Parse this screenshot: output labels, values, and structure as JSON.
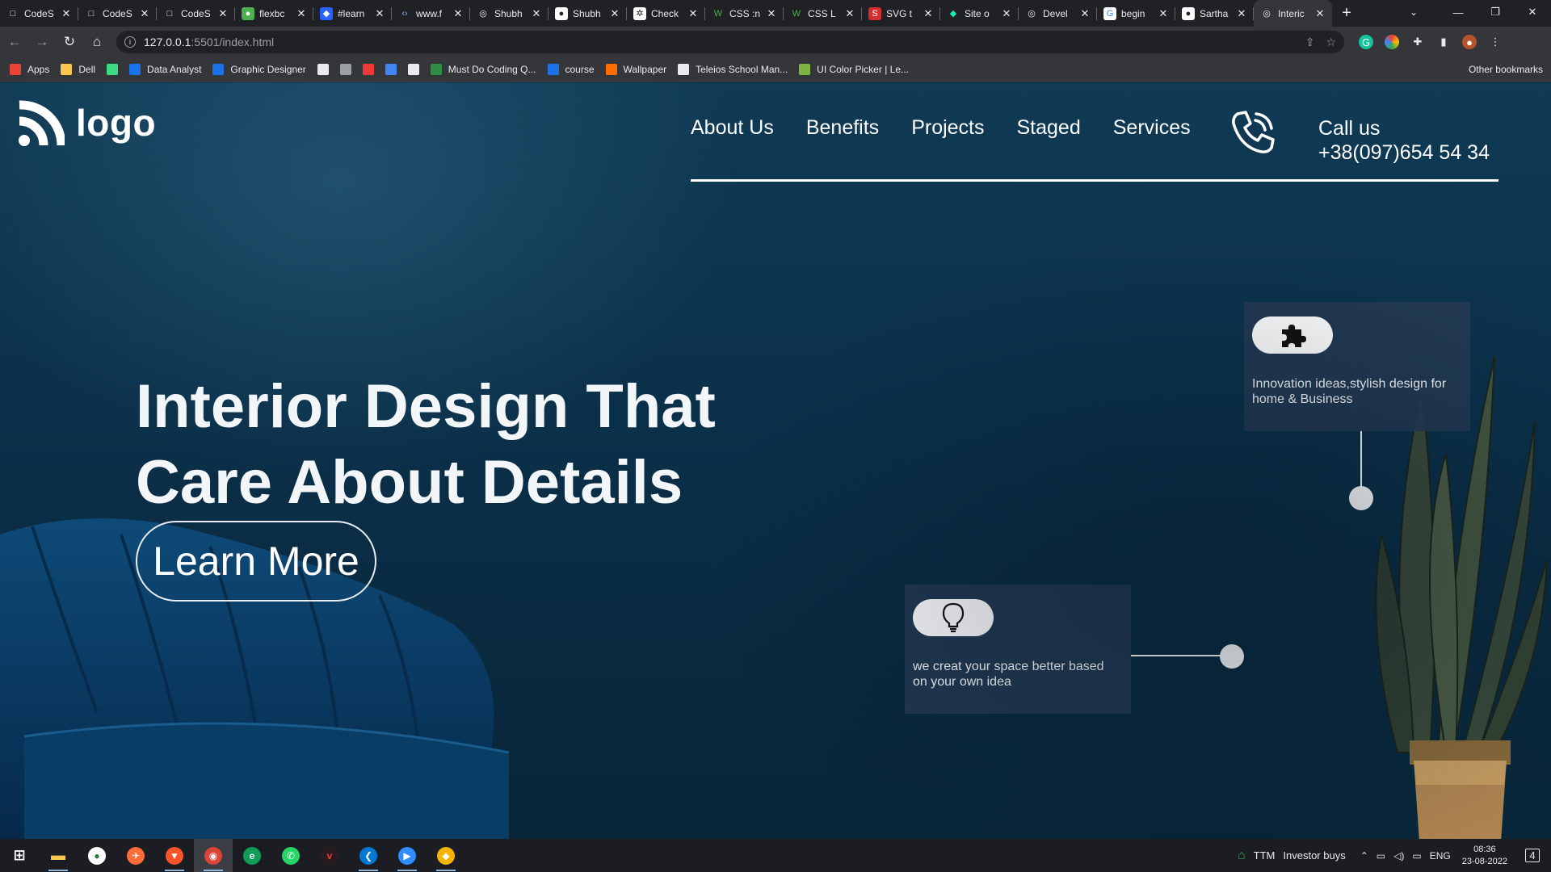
{
  "browser": {
    "tabs": [
      {
        "title": "CodeS",
        "icon": "page-icon",
        "icon_bg": "#202124",
        "icon_color": "#e8eaed",
        "glyph": "□"
      },
      {
        "title": "CodeS",
        "icon": "page-icon",
        "icon_bg": "#202124",
        "icon_color": "#e8eaed",
        "glyph": "□"
      },
      {
        "title": "CodeS",
        "icon": "page-icon",
        "icon_bg": "#202124",
        "icon_color": "#e8eaed",
        "glyph": "□"
      },
      {
        "title": "flexbc",
        "icon": "frog-icon",
        "icon_bg": "#4caf50",
        "icon_color": "#ffffff",
        "glyph": "●"
      },
      {
        "title": "#learn",
        "icon": "hashnode-icon",
        "icon_bg": "#2962ff",
        "icon_color": "#ffffff",
        "glyph": "◆"
      },
      {
        "title": "www.f",
        "icon": "code-icon",
        "icon_bg": "#202124",
        "icon_color": "#8ab4f8",
        "glyph": "‹›"
      },
      {
        "title": "Shubh",
        "icon": "globe-icon",
        "icon_bg": "#202124",
        "icon_color": "#e8eaed",
        "glyph": "◎"
      },
      {
        "title": "Shubh",
        "icon": "github-icon",
        "icon_bg": "#ffffff",
        "icon_color": "#202124",
        "glyph": "●"
      },
      {
        "title": "Check",
        "icon": "chatgpt-icon",
        "icon_bg": "#ffffff",
        "icon_color": "#202124",
        "glyph": "✲"
      },
      {
        "title": "CSS :n",
        "icon": "w3schools-icon",
        "icon_bg": "#202124",
        "icon_color": "#4caf50",
        "glyph": "W"
      },
      {
        "title": "CSS L",
        "icon": "w3schools-icon",
        "icon_bg": "#202124",
        "icon_color": "#4caf50",
        "glyph": "W"
      },
      {
        "title": "SVG t",
        "icon": "svg-icon",
        "icon_bg": "#d32f2f",
        "icon_color": "#ffffff",
        "glyph": "S"
      },
      {
        "title": "Site o",
        "icon": "diamond-icon",
        "icon_bg": "#202124",
        "icon_color": "#1de9b6",
        "glyph": "◆"
      },
      {
        "title": "Devel",
        "icon": "globe-icon",
        "icon_bg": "#202124",
        "icon_color": "#e8eaed",
        "glyph": "◎"
      },
      {
        "title": "begin",
        "icon": "google-icon",
        "icon_bg": "#ffffff",
        "icon_color": "#4285f4",
        "glyph": "G"
      },
      {
        "title": "Sartha",
        "icon": "github-icon",
        "icon_bg": "#ffffff",
        "icon_color": "#202124",
        "glyph": "●"
      },
      {
        "title": "Interic",
        "icon": "globe-icon",
        "icon_bg": "#35363a",
        "icon_color": "#e8eaed",
        "glyph": "◎",
        "active": true
      }
    ],
    "url_host": "127.0.0.1",
    "url_path": ":5501/index.html",
    "bookmarks": [
      {
        "label": "Apps",
        "icon": "apps-grid-icon",
        "color": "#ea4335"
      },
      {
        "label": "Dell",
        "icon": "folder-icon",
        "color": "#f9c74f"
      },
      {
        "label": "",
        "icon": "android-icon",
        "color": "#3ddc84"
      },
      {
        "label": "Data Analyst",
        "icon": "video-icon",
        "color": "#1a73e8"
      },
      {
        "label": "Graphic Designer",
        "icon": "video-icon",
        "color": "#1a73e8"
      },
      {
        "label": "",
        "icon": "globe-icon",
        "color": "#e8eaed"
      },
      {
        "label": "",
        "icon": "mountain-icon",
        "color": "#9aa0a6"
      },
      {
        "label": "",
        "icon": "vivaldi-icon",
        "color": "#ef3939"
      },
      {
        "label": "",
        "icon": "pliers-icon",
        "color": "#4285f4"
      },
      {
        "label": "",
        "icon": "grid-icon",
        "color": "#e8eaed"
      },
      {
        "label": "Must Do Coding Q...",
        "icon": "gfg-icon",
        "color": "#2f8d46"
      },
      {
        "label": "course",
        "icon": "c-icon",
        "color": "#1a73e8"
      },
      {
        "label": "Wallpaper",
        "icon": "flame-icon",
        "color": "#ff6d00"
      },
      {
        "label": "Teleios School Man...",
        "icon": "doc-icon",
        "color": "#e8eaed"
      },
      {
        "label": "UI Color Picker | Le...",
        "icon": "play-icon",
        "color": "#7cb342"
      }
    ],
    "other_bookmarks": "Other bookmarks"
  },
  "site": {
    "logo_text": "logo",
    "nav": [
      "About Us",
      "Benefits",
      "Projects",
      "Staged",
      "Services"
    ],
    "call_label": "Call us",
    "call_number": "+38(097)654 54 34",
    "hero_line1": "Interior Design That",
    "hero_line2": "Care About Details",
    "cta": "Learn More",
    "card1_text": "Innovation ideas,stylish design for home & Business",
    "card2_text": "we creat your space better based on your own idea"
  },
  "taskbar": {
    "apps": [
      {
        "name": "start-button",
        "glyph": "⊞",
        "color": "#ffffff",
        "bg": "transparent"
      },
      {
        "name": "file-explorer-icon",
        "glyph": "▬",
        "color": "#f9c74f",
        "bg": "transparent",
        "open": true
      },
      {
        "name": "app-green-icon",
        "glyph": "●",
        "color": "#2e7d32",
        "bg": "#ffffff"
      },
      {
        "name": "postman-icon",
        "glyph": "✈",
        "color": "#ffffff",
        "bg": "#ff6c37"
      },
      {
        "name": "brave-icon",
        "glyph": "▼",
        "color": "#ffffff",
        "bg": "#fb542b",
        "open": true
      },
      {
        "name": "chrome-icon",
        "glyph": "◉",
        "color": "#ffffff",
        "bg": "#db4437",
        "open": true,
        "active": true
      },
      {
        "name": "edge-icon",
        "glyph": "e",
        "color": "#ffffff",
        "bg": "#0f9d58"
      },
      {
        "name": "whatsapp-icon",
        "glyph": "✆",
        "color": "#ffffff",
        "bg": "#25d366"
      },
      {
        "name": "vivaldi-icon",
        "glyph": "v",
        "color": "#ef3939",
        "bg": "#2a1a20"
      },
      {
        "name": "vscode-icon",
        "glyph": "❮",
        "color": "#ffffff",
        "bg": "#0078d4",
        "open": true
      },
      {
        "name": "zoom-icon",
        "glyph": "▶",
        "color": "#ffffff",
        "bg": "#2d8cff",
        "open": true
      },
      {
        "name": "git-icon",
        "glyph": "◆",
        "color": "#ffffff",
        "bg": "#f4b400",
        "open": true
      }
    ],
    "ticker_symbol": "TTM",
    "ticker_text": "Investor buys",
    "lang": "ENG",
    "time": "08:36",
    "date": "23-08-2022",
    "notifications": "4"
  }
}
